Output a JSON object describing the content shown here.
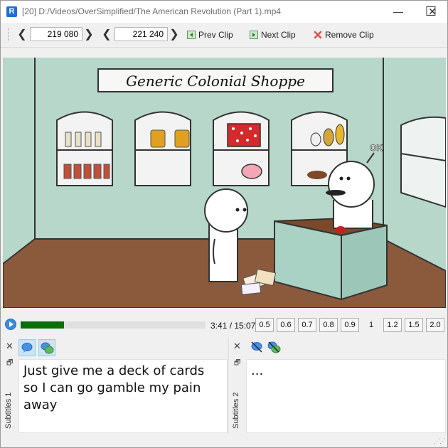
{
  "window": {
    "title": "[20] D:/Videos/OverSimplified/The American Revolution (Part 1).mp4",
    "app_icon_letter": "R",
    "minimize_glyph": "—",
    "maximize_glyph": "☐",
    "close_glyph": "✕"
  },
  "toolbar": {
    "start_time": "219 080",
    "end_time": "221 240",
    "prev_clip_label": "Prev Clip",
    "next_clip_label": "Next Clip",
    "remove_clip_label": "Remove Clip",
    "prev_arrow": "❮",
    "next_arrow": "❯"
  },
  "video": {
    "shop_sign": "Generic Colonial Shoppe",
    "speech": "OK"
  },
  "playback": {
    "time": "3:41 / 15:07",
    "progress_fraction": 0.235,
    "speeds": [
      "0.5",
      "0.6",
      "0.7",
      "0.8",
      "0.9",
      "1",
      "1.2",
      "1.5",
      "2.0"
    ],
    "selected_speed": "1"
  },
  "subtitles": [
    {
      "label": "Subtitles 1",
      "text": "Just give me a deck of cards\nso I can go gamble my pain\naway"
    },
    {
      "label": "Subtitles 2",
      "text": "..."
    }
  ],
  "colors": {
    "accent": "#1f6fd6",
    "progress": "#0a6e0a",
    "wall": "#b6d7c9",
    "floor": "#8b5a3c"
  }
}
